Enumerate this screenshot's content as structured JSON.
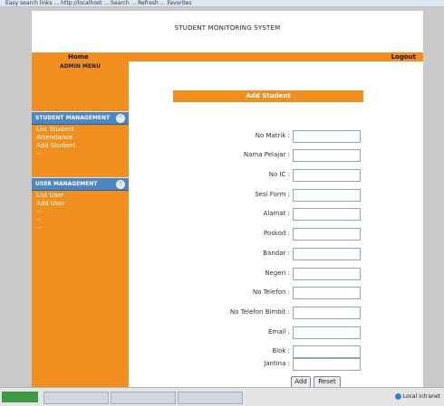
{
  "browser": {
    "toolbar_text": "Easy  search links  ...  http://localhost  ...  Search  ...  Refresh  ...  Favorites"
  },
  "header": {
    "title": "STUDENT MONITORING SYSTEM"
  },
  "nav": {
    "home": "Home",
    "logout": "Logout"
  },
  "sidebar": {
    "admin_menu": "ADMIN MENU",
    "student_section": {
      "title": "STUDENT MANAGEMENT",
      "items": [
        "List Student",
        "Attendance",
        "Add Student",
        "--"
      ]
    },
    "user_section": {
      "title": "USER MANAGEMENT",
      "items": [
        "List User",
        "Add User",
        "--",
        "--",
        "--"
      ]
    }
  },
  "form": {
    "title": "Add Student",
    "fields": [
      {
        "label": "No Matrik :",
        "value": ""
      },
      {
        "label": "Nama Pelajar :",
        "value": ""
      },
      {
        "label": "No IC :",
        "value": ""
      },
      {
        "label": "Sesi Form :",
        "value": ""
      },
      {
        "label": "Alamat :",
        "value": ""
      },
      {
        "label": "Poskod :",
        "value": ""
      },
      {
        "label": "Bandar :",
        "value": ""
      },
      {
        "label": "Negeri :",
        "value": ""
      },
      {
        "label": "No Telefon :",
        "value": ""
      },
      {
        "label": "No Telefon Bimbit :",
        "value": ""
      },
      {
        "label": "Email :",
        "value": ""
      },
      {
        "label": "Blok :",
        "value": ""
      },
      {
        "label": "Jantina :",
        "value": ""
      }
    ],
    "add_label": "Add",
    "reset_label": "Reset"
  },
  "statusbar": {
    "zone": "Local intranet"
  },
  "colors": {
    "accent": "#f18f1e",
    "section_header": "#4d86c4"
  }
}
